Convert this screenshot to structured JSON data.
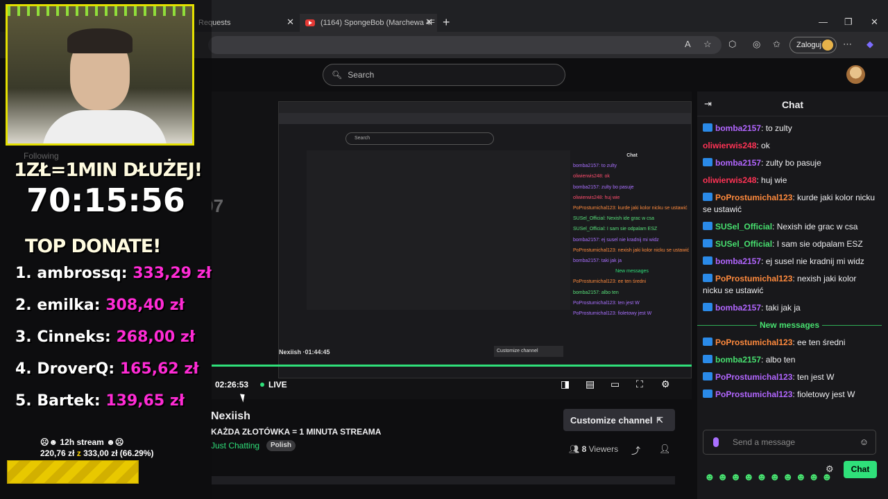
{
  "browser": {
    "tabs": [
      {
        "label": "Requests"
      },
      {
        "label": "(1164) SpongeBob (Marchewa 4F"
      }
    ],
    "login_label": "Zaloguj"
  },
  "twitch": {
    "search_placeholder": "Search",
    "channel": {
      "name": "Nexiish",
      "title": "KAŻDA ZŁOTÓWKA = 1 MINUTA STREAMA",
      "category": "Just Chatting",
      "tag": "Polish",
      "viewers_count": "8",
      "viewers_label": "Viewers",
      "customize_label": "Customize channel"
    },
    "player": {
      "time": "02:26:53",
      "live_label": "LIVE"
    }
  },
  "chat": {
    "title": "Chat",
    "messages": [
      {
        "user": "bomba2157",
        "text": ": to zulty",
        "color": "#b266ff",
        "badge": true
      },
      {
        "user": "oliwierwis248",
        "text": ": ok",
        "color": "#ff3355",
        "badge": false
      },
      {
        "user": "bomba2157",
        "text": ": zulty bo pasuje",
        "color": "#b266ff",
        "badge": true
      },
      {
        "user": "oliwierwis248",
        "text": ": huj wie",
        "color": "#ff3355",
        "badge": false
      },
      {
        "user": "PoProstumichal123",
        "text": ": kurde jaki kolor nicku se ustawić",
        "color": "#ff8a3d",
        "badge": true
      },
      {
        "user": "SUSel_Official",
        "text": ": Nexish ide grac w csa",
        "color": "#47e06f",
        "badge": true
      },
      {
        "user": "SUSel_Official",
        "text": ": I sam sie odpalam ESZ",
        "color": "#47e06f",
        "badge": true
      },
      {
        "user": "bomba2157",
        "text": ": ej susel nie kradnij mi widz",
        "color": "#b266ff",
        "badge": true
      },
      {
        "user": "PoProstumichal123",
        "text": ": nexish jaki kolor nicku se ustawić",
        "color": "#ff8a3d",
        "badge": true
      },
      {
        "user": "bomba2157",
        "text": ": taki jak ja",
        "color": "#b266ff",
        "badge": true
      }
    ],
    "new_messages_label": "New messages",
    "new_messages": [
      {
        "user": "PoProstumichal123",
        "text": ": ee ten średni",
        "color": "#ff8a3d",
        "badge": true
      },
      {
        "user": "bomba2157",
        "text": ": albo ten",
        "color": "#47e06f",
        "badge": true
      },
      {
        "user": "PoProstumichal123",
        "text": ": ten jest W",
        "color": "#b266ff",
        "badge": true
      },
      {
        "user": "PoProstumichal123",
        "text": ": fioletowy jest W",
        "color": "#b266ff",
        "badge": true
      }
    ],
    "input_placeholder": "Send a message",
    "send_label": "Chat"
  },
  "overlay": {
    "heading": "1ZŁ=1MIN DŁUŻEJ!",
    "timer": "70:15:56",
    "top_donate_label": "TOP DONATE!",
    "donations": [
      {
        "name": "1. ambrossq:",
        "amount": "333,29 zł"
      },
      {
        "name": "2. emilka:",
        "amount": "308,40 zł"
      },
      {
        "name": "3. Cinneks:",
        "amount": "268,00 zł"
      },
      {
        "name": "4. DroverQ:",
        "amount": "165,62 zł"
      },
      {
        "name": "5. Bartek:",
        "amount": "139,65 zł"
      }
    ],
    "goal_title": "12h stream",
    "goal_current": "220,76 zł",
    "goal_sep": "z",
    "goal_target": "333,00 zł",
    "goal_percent": "(66.29%)",
    "goal_fraction": 0.6629
  },
  "inner_view": {
    "following": "Following",
    "chat_title": "Chat",
    "new_messages": "New messages",
    "name": "Nexiish",
    "elapsed": "01:44:45",
    "customize": "Customize channel",
    "timer_ghost": "6:07"
  }
}
